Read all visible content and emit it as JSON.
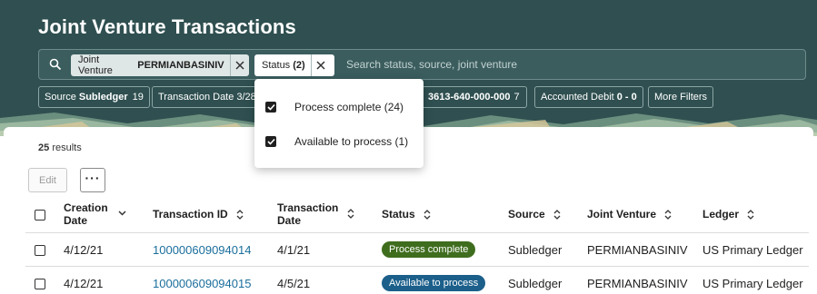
{
  "page": {
    "title": "Joint Venture Transactions"
  },
  "search": {
    "placeholder": "Search status, source, joint venture",
    "chips": [
      {
        "label": "Joint Venture",
        "value": "PERMIANBASINIV"
      },
      {
        "label": "Status",
        "value": "(2)"
      }
    ]
  },
  "filters": [
    {
      "label": "Source",
      "value": "Subledger",
      "count": "19"
    },
    {
      "label": "Transaction Date",
      "value": "3/28"
    },
    {
      "label": "",
      "value": "3613-640-000-000",
      "count": "7"
    },
    {
      "label": "Accounted Debit",
      "value": "0 - 0"
    },
    {
      "label": "More Filters",
      "value": ""
    }
  ],
  "dropdown": {
    "options": [
      {
        "label": "Process complete (24)",
        "checked": true
      },
      {
        "label": "Available to process (1)",
        "checked": true
      }
    ]
  },
  "results": {
    "count": "25",
    "label": "results"
  },
  "toolbar": {
    "edit_label": "Edit",
    "more_label": "···"
  },
  "table": {
    "columns": [
      {
        "label_line1": "Creation",
        "label_line2": "Date",
        "sort_icon": "chevron-down-icon"
      },
      {
        "label_line1": "Transaction ID",
        "label_line2": "",
        "sort_icon": "sort-icon"
      },
      {
        "label_line1": "Transaction",
        "label_line2": "Date",
        "sort_icon": "sort-icon"
      },
      {
        "label_line1": "Status",
        "label_line2": "",
        "sort_icon": "sort-icon"
      },
      {
        "label_line1": "Source",
        "label_line2": "",
        "sort_icon": "sort-icon"
      },
      {
        "label_line1": "Joint Venture",
        "label_line2": "",
        "sort_icon": "sort-icon"
      },
      {
        "label_line1": "Ledger",
        "label_line2": "",
        "sort_icon": "sort-icon"
      }
    ],
    "rows": [
      {
        "creation_date": "4/12/21",
        "transaction_id": "100000609094014",
        "transaction_date": "4/1/21",
        "status": "Process complete",
        "status_color": "#3f6d1e",
        "source": "Subledger",
        "joint_venture": "PERMIANBASINIV",
        "ledger": "US Primary Ledger"
      },
      {
        "creation_date": "4/12/21",
        "transaction_id": "100000609094015",
        "transaction_date": "4/5/21",
        "status": "Available to process",
        "status_color": "#1b5f8a",
        "source": "Subledger",
        "joint_venture": "PERMIANBASINIV",
        "ledger": "US Primary Ledger"
      }
    ]
  },
  "colors": {
    "header_bg": "#2f4f50",
    "link": "#1a6e9c"
  }
}
